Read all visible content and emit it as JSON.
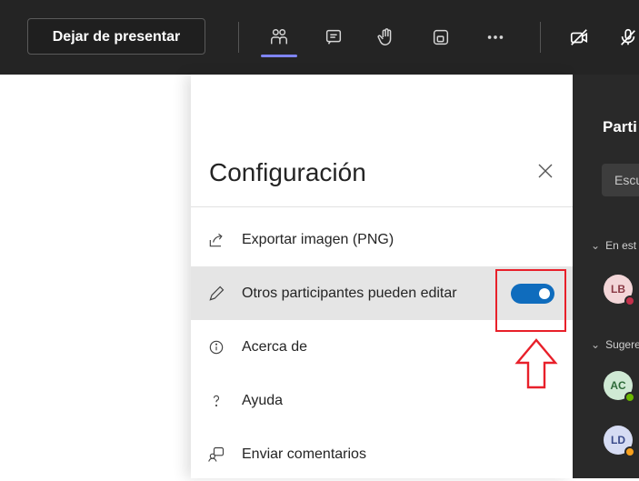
{
  "toolbar": {
    "stop_presenting": "Dejar de presentar",
    "icons": [
      "people-icon",
      "chat-icon",
      "raise-hand-icon",
      "breakout-rooms-icon",
      "more-icon",
      "camera-off-icon",
      "mic-off-icon"
    ],
    "active_accent": "#7f85f5"
  },
  "settings": {
    "title": "Configuración",
    "items": [
      {
        "label": "Exportar imagen (PNG)",
        "icon": "export-icon"
      },
      {
        "label": "Otros participantes pueden editar",
        "icon": "pencil-icon",
        "toggle_on": true
      },
      {
        "label": "Acerca de",
        "icon": "info-icon"
      },
      {
        "label": "Ayuda",
        "icon": "help-icon"
      },
      {
        "label": "Enviar comentarios",
        "icon": "feedback-icon"
      }
    ],
    "toggle_color": "#0f6cbd",
    "highlight_color": "#e8202a"
  },
  "participants": {
    "title": "Parti",
    "search_placeholder": "Escu",
    "sections": [
      {
        "label": "En est"
      },
      {
        "label": "Sugere"
      }
    ],
    "people": [
      {
        "initials": "LB",
        "status_color": "#c4314b"
      },
      {
        "initials": "AC",
        "status_color": "#6bb700"
      },
      {
        "initials": "LD",
        "status_color": "#f8a01c"
      }
    ]
  }
}
